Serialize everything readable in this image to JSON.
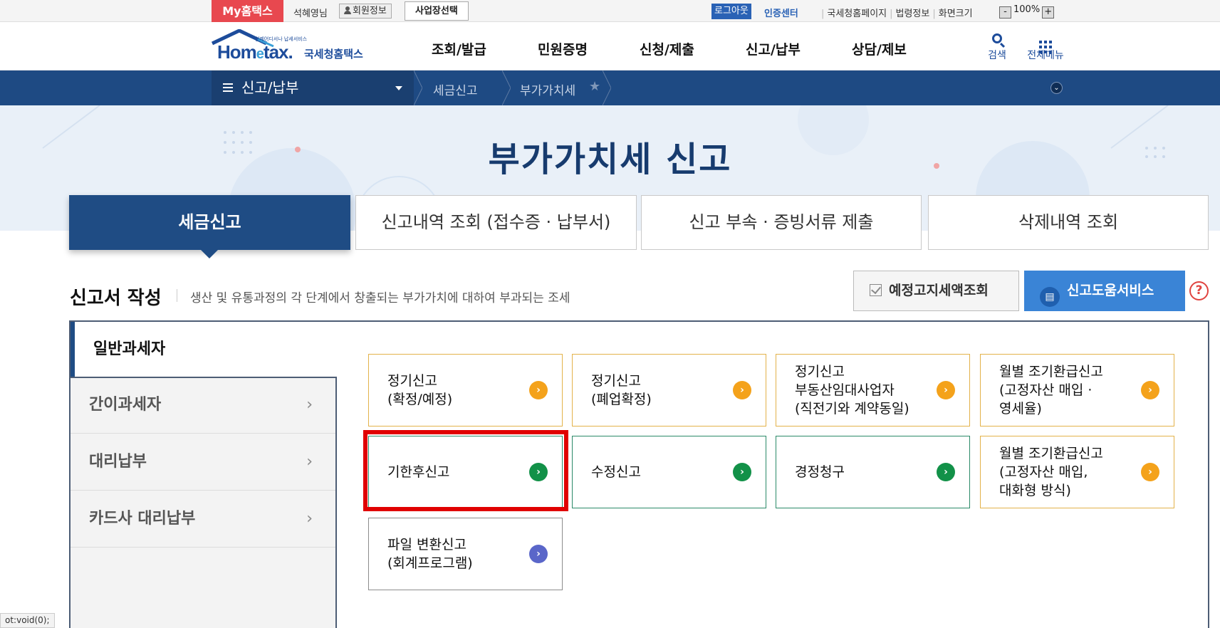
{
  "utility_bar": {
    "my_hometax": "My홈택스",
    "user_name": "석혜영님",
    "member_info": "회원정보",
    "business_select": "사업장선택",
    "logout": "로그아웃",
    "auth_center": "인증센터",
    "links": [
      "국세청홈페이지",
      "법령정보",
      "화면크기"
    ],
    "zoom_minus": "-",
    "zoom_value": "100%",
    "zoom_plus": "+"
  },
  "header": {
    "logo_main": "Hom",
    "logo_e": "e",
    "logo_tax": "tax.",
    "logo_korean": "국세청홈택스",
    "logo_tagline": "언제어디서나 납세서비스",
    "nav": [
      "조회/발급",
      "민원증명",
      "신청/제출",
      "신고/납부",
      "상담/제보"
    ],
    "search_label": "검색",
    "all_menu_label": "전체메뉴"
  },
  "breadcrumb": {
    "menu_label": "신고/납부",
    "items": [
      "세금신고",
      "부가가치세"
    ],
    "star": "★",
    "toggle": "⌄"
  },
  "hero": {
    "title": "부가가치세 신고"
  },
  "tabs": [
    {
      "label": "세금신고",
      "active": true
    },
    {
      "label": "신고내역 조회 (접수증 · 납부서)",
      "active": false
    },
    {
      "label": "신고 부속 · 증빙서류 제출",
      "active": false
    },
    {
      "label": "삭제내역 조회",
      "active": false
    }
  ],
  "section": {
    "title": "신고서 작성",
    "description": "생산 및 유통과정의 각 단계에서 창출되는 부가가치에 대하여 부과되는 조세",
    "notice_button": "예정고지세액조회",
    "help_button": "신고도움서비스",
    "help_question": "?"
  },
  "sidebar": {
    "active": "일반과세자",
    "items": [
      "간이과세자",
      "대리납부",
      "카드사 대리납부"
    ],
    "chevron": "›"
  },
  "cards": {
    "row1": [
      {
        "line1": "정기신고",
        "line2": "(확정/예정)",
        "line3": ""
      },
      {
        "line1": "정기신고",
        "line2": "(폐업확정)",
        "line3": ""
      },
      {
        "line1": "정기신고",
        "line2": "부동산임대사업자",
        "line3": "(직전기와 계약동일)"
      },
      {
        "line1": "월별 조기환급신고",
        "line2": "(고정자산 매입 ·",
        "line3": "영세율)"
      }
    ],
    "row2": [
      {
        "line1": "기한후신고"
      },
      {
        "line1": "수정신고"
      },
      {
        "line1": "경정청구"
      },
      {
        "line1": "월별 조기환급신고",
        "line2": "(고정자산 매입,",
        "line3": "대화형 방식)"
      }
    ],
    "row3": [
      {
        "line1": "파일 변환신고",
        "line2": "(회계프로그램)"
      }
    ],
    "arrow": "›"
  },
  "status_tip": "ot:void(0);",
  "colors": {
    "brand_navy": "#1f4c84",
    "accent_blue": "#3a84d6",
    "highlight_red": "#e00000",
    "orange": "#f4a21b",
    "green": "#129148"
  }
}
